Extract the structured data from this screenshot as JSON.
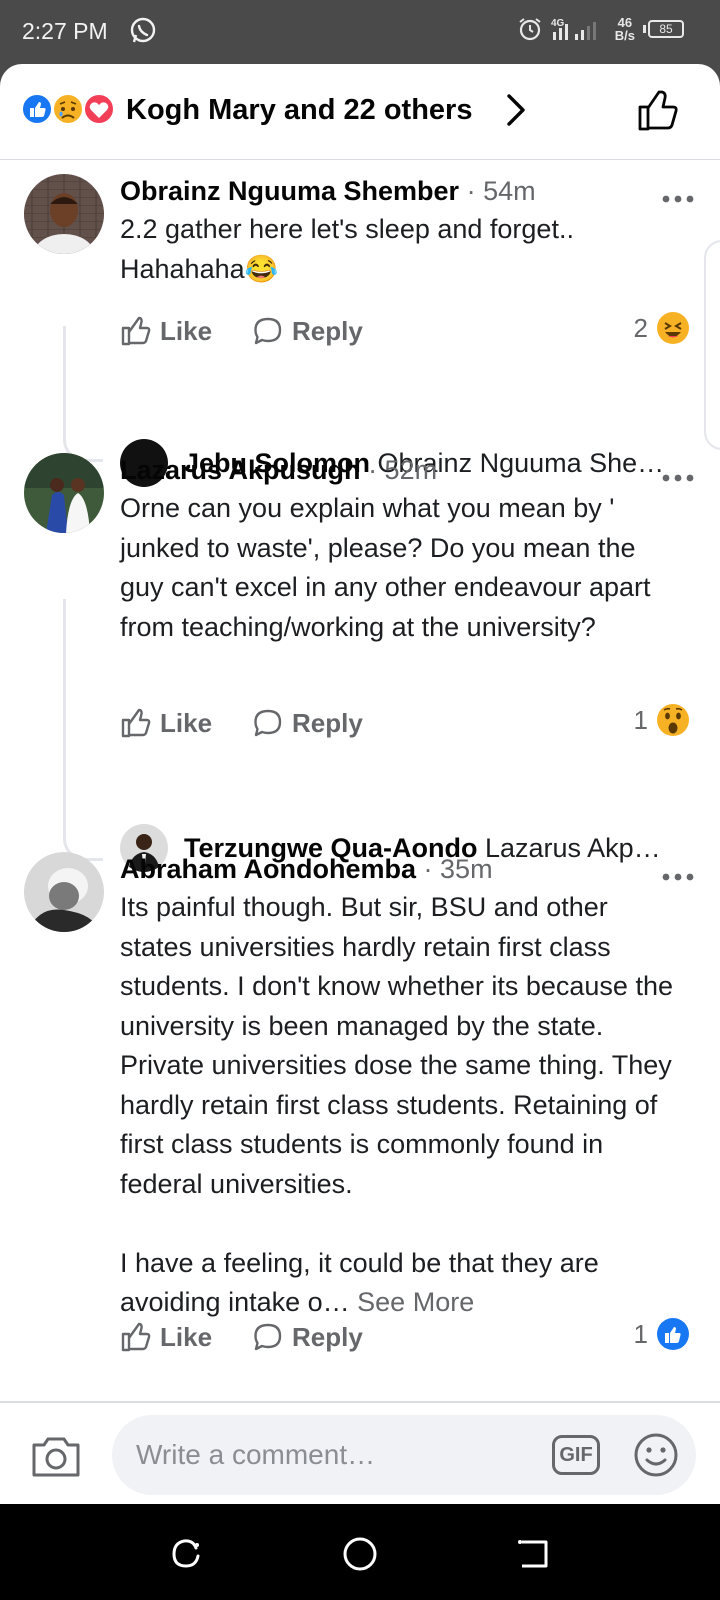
{
  "status_bar": {
    "time": "2:27 PM",
    "network_top": "4G",
    "speed_value": "46",
    "speed_unit": "B/s",
    "battery": "85",
    "icons": [
      "whatsapp-icon",
      "alarm-icon",
      "signal-icon",
      "battery-icon"
    ]
  },
  "reactions_header": {
    "summary": "Kogh Mary and 22 others",
    "icons": [
      "like-reaction-icon",
      "sad-reaction-icon",
      "love-reaction-icon"
    ],
    "colors": {
      "like": "#1877f2",
      "love": "#f33e58",
      "sad": "#f7b125"
    }
  },
  "comments": [
    {
      "name": "Obrainz Nguuma Shember",
      "time": "· 54m",
      "text": "2.2 gather here let's sleep and forget.. Hahahaha😂",
      "like_label": "Like",
      "reply_label": "Reply",
      "reaction_count": "2",
      "reaction": "laughing",
      "reply_preview": {
        "name": "Jebu Solomon",
        "text": "Obrainz Nguuma She…"
      }
    },
    {
      "name": "Lazarus Akpusugh",
      "time": "· 52m",
      "text": "Orne can you explain what you mean by ' junked to waste', please? Do you mean the guy can't excel in any other endeavour apart from teaching/working at the university?",
      "like_label": "Like",
      "reply_label": "Reply",
      "reaction_count": "1",
      "reaction": "wow",
      "reply_preview": {
        "name": "Terzungwe Qua-Aondo",
        "text": "Lazarus Akp…"
      }
    },
    {
      "name": "Abraham Aondohemba",
      "time": "· 35m",
      "text": "Its painful though. But sir, BSU and other states universities hardly retain first class students. I don't know whether its because the university is been managed by the state. Private universities dose the same thing. They hardly retain first class students. Retaining of first class students is commonly found in federal universities.\n\nI have a feeling, it could be that they are avoiding intake o… ",
      "see_more": "See More",
      "like_label": "Like",
      "reply_label": "Reply",
      "reaction_count": "1",
      "reaction": "like"
    }
  ],
  "composer": {
    "placeholder": "Write a comment…",
    "gif_label": "GIF"
  },
  "nav": [
    "recents-icon",
    "home-icon",
    "back-icon"
  ]
}
